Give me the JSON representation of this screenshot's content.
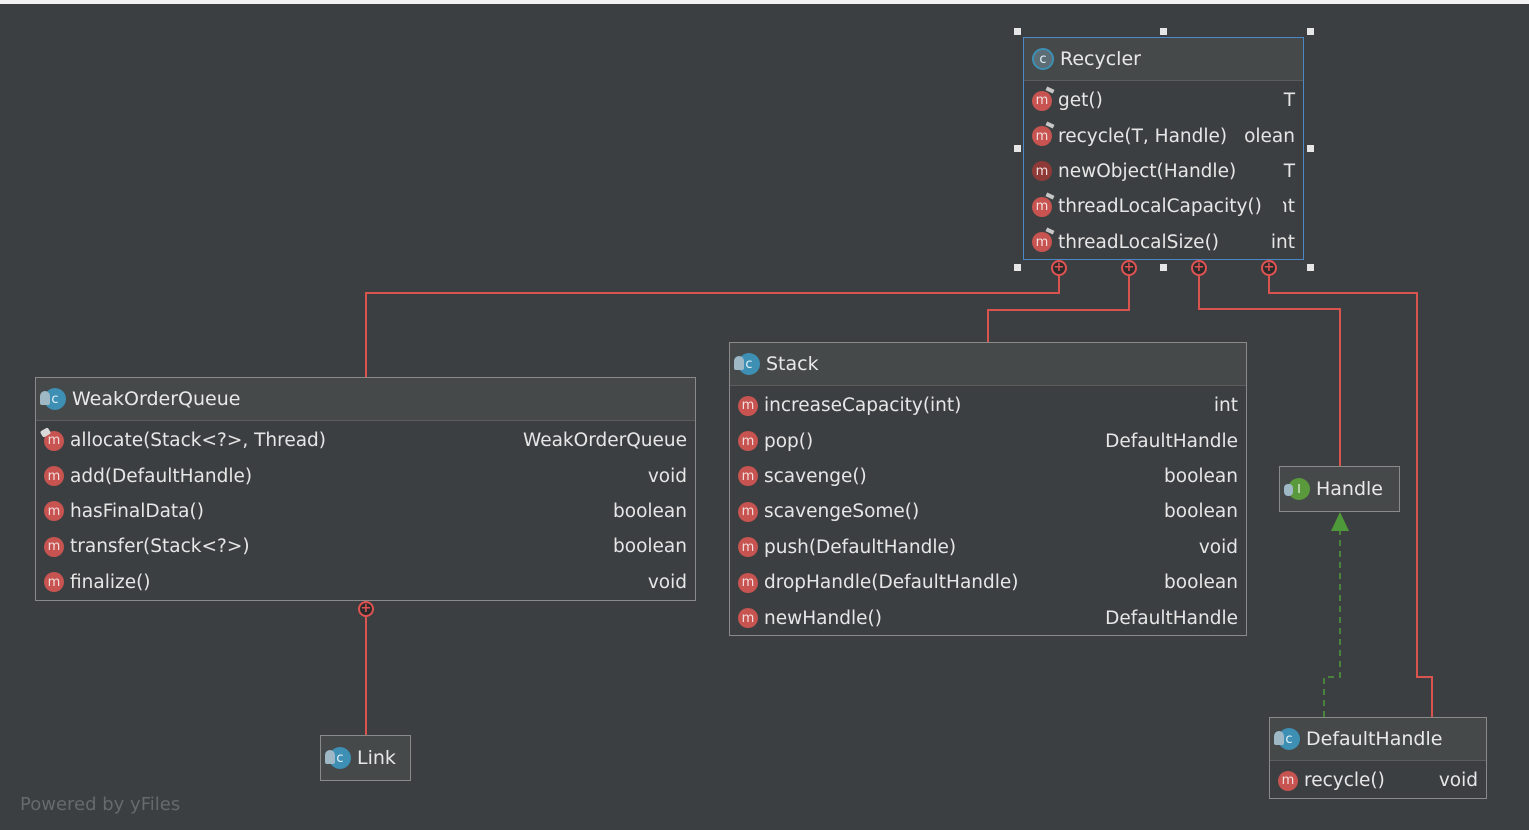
{
  "diagram": {
    "watermark": "Powered by yFiles",
    "colors": {
      "background": "#3c3f41",
      "node_border": "#8a8a8a",
      "selection": "#4a88c7",
      "composition_edge": "#d9534f",
      "implements_edge": "#4e9a3a",
      "method_icon": "#c75450",
      "class_icon": "#3d8fb4",
      "interface_icon": "#5a9a3c"
    },
    "nodes": {
      "recycler": {
        "title": "Recycler",
        "icon": "abstract-class-icon",
        "members": [
          {
            "name": "get()",
            "type": "T",
            "icon": "method-icon"
          },
          {
            "name": "recycle(T, Handle)",
            "type": "boolean",
            "icon": "method-icon"
          },
          {
            "name": "newObject(Handle)",
            "type": "T",
            "icon": "abstract-method-icon"
          },
          {
            "name": "threadLocalCapacity()",
            "type": "int",
            "icon": "method-icon"
          },
          {
            "name": "threadLocalSize()",
            "type": "int",
            "icon": "method-icon"
          }
        ]
      },
      "weak_order_queue": {
        "title": "WeakOrderQueue",
        "icon": "class-icon",
        "members": [
          {
            "name": "allocate(Stack<?>, Thread)",
            "type": "WeakOrderQueue",
            "icon": "static-method-icon"
          },
          {
            "name": "add(DefaultHandle)",
            "type": "void",
            "icon": "method-icon"
          },
          {
            "name": "hasFinalData()",
            "type": "boolean",
            "icon": "method-icon"
          },
          {
            "name": "transfer(Stack<?>)",
            "type": "boolean",
            "icon": "method-icon"
          },
          {
            "name": "finalize()",
            "type": "void",
            "icon": "method-icon"
          }
        ]
      },
      "stack": {
        "title": "Stack",
        "icon": "class-icon",
        "members": [
          {
            "name": "increaseCapacity(int)",
            "type": "int",
            "icon": "method-icon"
          },
          {
            "name": "pop()",
            "type": "DefaultHandle",
            "icon": "method-icon"
          },
          {
            "name": "scavenge()",
            "type": "boolean",
            "icon": "method-icon"
          },
          {
            "name": "scavengeSome()",
            "type": "boolean",
            "icon": "method-icon"
          },
          {
            "name": "push(DefaultHandle)",
            "type": "void",
            "icon": "method-icon"
          },
          {
            "name": "dropHandle(DefaultHandle)",
            "type": "boolean",
            "icon": "method-icon"
          },
          {
            "name": "newHandle()",
            "type": "DefaultHandle",
            "icon": "method-icon"
          }
        ]
      },
      "handle": {
        "title": "Handle",
        "icon": "interface-icon"
      },
      "default_handle": {
        "title": "DefaultHandle",
        "icon": "class-icon",
        "members": [
          {
            "name": "recycle()",
            "type": "void",
            "icon": "method-icon"
          }
        ]
      },
      "link": {
        "title": "Link",
        "icon": "class-icon"
      }
    }
  }
}
